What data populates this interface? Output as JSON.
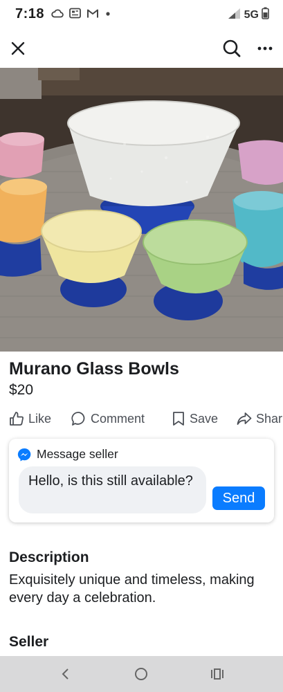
{
  "status_bar": {
    "time": "7:18",
    "network": "5G",
    "icons": [
      "cloud-icon",
      "newspaper-icon",
      "gmail-icon",
      "dot-icon",
      "signal-icon",
      "battery-icon"
    ]
  },
  "top_bar": {
    "icons": [
      "close-icon",
      "search-icon",
      "more-icon"
    ]
  },
  "listing": {
    "title": "Murano Glass Bowls",
    "price": "$20",
    "photo_icon": "colored-glass-bowls-photo"
  },
  "actions": {
    "like": "Like",
    "comment": "Comment",
    "save": "Save",
    "share": "Shar"
  },
  "message": {
    "header": "Message seller",
    "text": "Hello, is this still available?",
    "send": "Send"
  },
  "description": {
    "heading": "Description",
    "text": "Exquisitely unique and timeless, making every day a celebration."
  },
  "seller": {
    "heading": "Seller"
  },
  "nav_bar": {
    "icons": [
      "back-icon",
      "home-icon",
      "recents-icon"
    ]
  },
  "colors": {
    "accent": "#0a7cff",
    "nav_bar": "#d9d9da",
    "bubble": "#eff1f4"
  }
}
